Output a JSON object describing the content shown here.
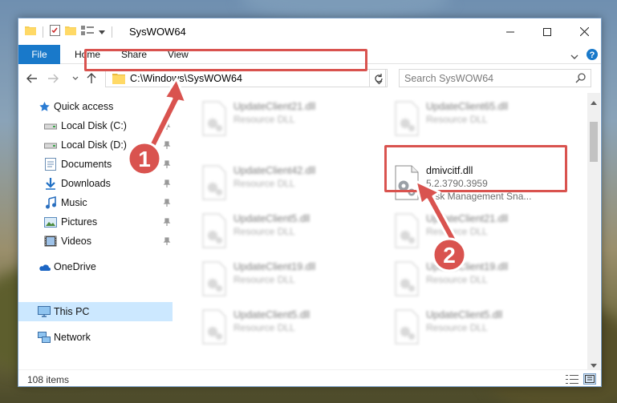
{
  "window": {
    "title": "SysWOW64",
    "controls": {
      "minimize": "—",
      "maximize": "☐",
      "close": "✕"
    }
  },
  "ribbon": {
    "tabs": [
      "File",
      "Home",
      "Share",
      "View"
    ]
  },
  "address": {
    "path": "C:\\Windows\\SysWOW64",
    "search_placeholder": "Search SysWOW64"
  },
  "nav": {
    "quick_access": "Quick access",
    "items": [
      {
        "label": "Local Disk (C:)",
        "icon": "drive-icon",
        "pinned": true
      },
      {
        "label": "Local Disk (D:)",
        "icon": "drive-icon",
        "pinned": true
      },
      {
        "label": "Documents",
        "icon": "documents-icon",
        "pinned": true
      },
      {
        "label": "Downloads",
        "icon": "downloads-icon",
        "pinned": true
      },
      {
        "label": "Music",
        "icon": "music-icon",
        "pinned": true
      },
      {
        "label": "Pictures",
        "icon": "pictures-icon",
        "pinned": true
      },
      {
        "label": "Videos",
        "icon": "videos-icon",
        "pinned": true
      }
    ],
    "onedrive": "OneDrive",
    "this_pc": "This PC",
    "network": "Network"
  },
  "files": {
    "left_column": [
      {
        "name": "UpdateClient21.dll",
        "type": "Resource DLL"
      },
      {
        "name": "UpdateClient42.dll",
        "type": "Resource DLL"
      },
      {
        "name": "UpdateClient5.dll",
        "type": "Resource DLL"
      },
      {
        "name": "UpdateClient19.dll",
        "type": "Resource DLL"
      },
      {
        "name": "UpdateClient5.dll",
        "type": "Resource DLL"
      }
    ],
    "right_column": [
      {
        "name": "UpdateClient65.dll",
        "type": "Resource DLL"
      },
      {
        "name": "UpdateClient21.dll",
        "type": "Resource DLL"
      },
      {
        "name": "UpdateClient19.dll",
        "type": "Resource DLL"
      },
      {
        "name": "UpdateClient5.dll",
        "type": "Resource DLL"
      }
    ],
    "highlighted": {
      "name": "dmivcitf.dll",
      "version": "5.2.3790.3959",
      "description": "Disk Management Sna..."
    }
  },
  "status": {
    "item_count": "108 items"
  },
  "annotations": [
    {
      "number": "1"
    },
    {
      "number": "2"
    }
  ],
  "colors": {
    "accent": "#1979ca",
    "highlight_border": "#d9534f",
    "callout_fill": "#d9534f",
    "selected_nav": "#cce8ff"
  }
}
